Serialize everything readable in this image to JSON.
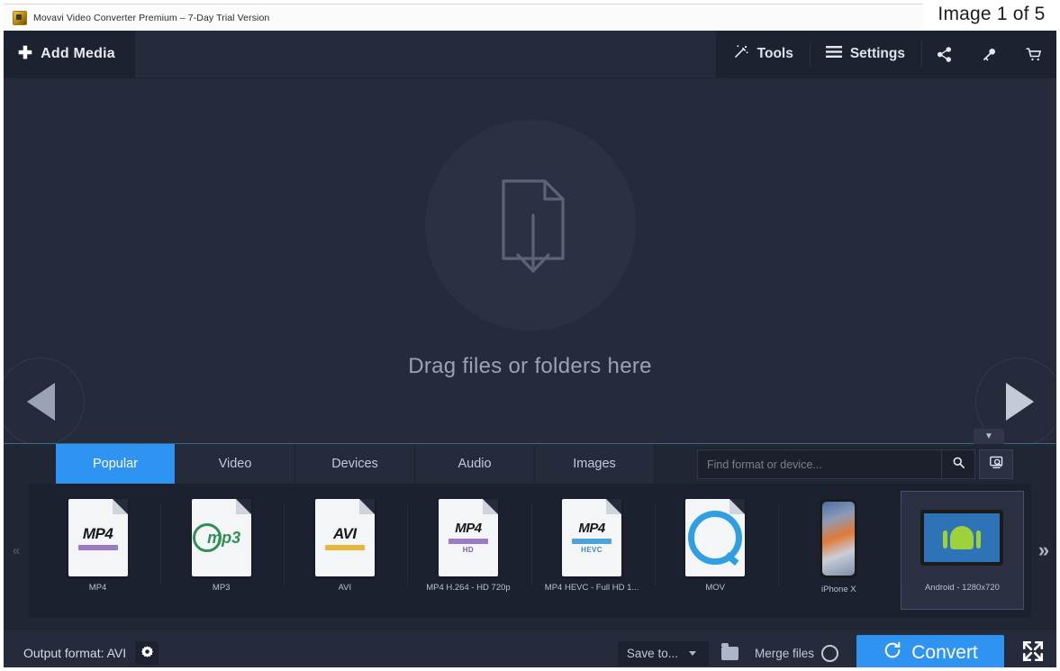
{
  "counter": {
    "text": "Image 1 of 5"
  },
  "titlebar": {
    "title": "Movavi Video Converter Premium – 7-Day Trial Version",
    "icon": "app-icon"
  },
  "toolbar": {
    "add_media_label": "Add Media",
    "plus_icon": "plus-icon",
    "tools_label": "Tools",
    "tools_icon": "magic-wand-icon",
    "settings_label": "Settings",
    "settings_icon": "hamburger-icon",
    "share_icon": "share-icon",
    "key_icon": "key-icon",
    "cart_icon": "cart-icon"
  },
  "dropzone": {
    "text": "Drag files or folders here",
    "file_icon": "file-download-icon",
    "prev_icon": "arrow-left-icon",
    "next_icon": "arrow-right-icon"
  },
  "format_panel": {
    "collapse_icon": "chevron-down-icon",
    "tabs": [
      {
        "label": "Popular",
        "active": true
      },
      {
        "label": "Video",
        "active": false
      },
      {
        "label": "Devices",
        "active": false
      },
      {
        "label": "Audio",
        "active": false
      },
      {
        "label": "Images",
        "active": false
      }
    ],
    "search": {
      "value": "",
      "placeholder": "Find format or device...",
      "search_icon": "search-icon",
      "device_search_icon": "device-search-icon"
    },
    "scroll_left_icon": "chevron-double-left-icon",
    "scroll_right_icon": "chevron-double-right-icon",
    "tiles": [
      {
        "label": "MP4",
        "icon": "mp4-file-icon",
        "selected": false
      },
      {
        "label": "MP3",
        "icon": "mp3-file-icon",
        "selected": false
      },
      {
        "label": "AVI",
        "icon": "avi-file-icon",
        "selected": false
      },
      {
        "label": "MP4 H.264 - HD 720p",
        "icon": "mp4-hd-file-icon",
        "selected": false
      },
      {
        "label": "MP4 HEVC - Full HD 1...",
        "icon": "mp4-hevc-file-icon",
        "selected": false
      },
      {
        "label": "MOV",
        "icon": "mov-file-icon",
        "selected": false
      },
      {
        "label": "iPhone X",
        "icon": "iphone-device-icon",
        "selected": false
      },
      {
        "label": "Android - 1280x720",
        "icon": "android-device-icon",
        "selected": true
      }
    ]
  },
  "bottom_bar": {
    "output_format_label": "Output format: AVI",
    "gear_icon": "gear-icon",
    "save_to_label": "Save to...",
    "caret_icon": "chevron-down-icon",
    "folder_icon": "folder-icon",
    "merge_files_label": "Merge files",
    "merge_toggle_icon": "toggle-off-icon",
    "convert_label": "Convert",
    "convert_icon": "refresh-icon",
    "expand_icon": "fullscreen-icon"
  },
  "colors": {
    "accent_blue": "#2f93f2",
    "window_bg": "#262b3b",
    "panel_bg": "#212635",
    "tiles_bg": "#1c2130",
    "toolbar_dark": "#1d2230"
  }
}
